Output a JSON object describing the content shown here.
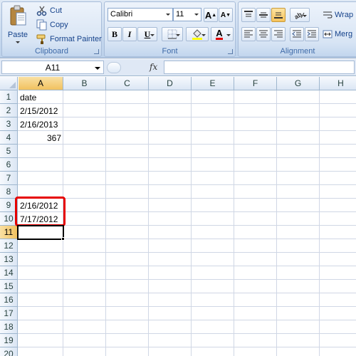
{
  "clipboard": {
    "paste_label": "Paste",
    "cut_label": "Cut",
    "copy_label": "Copy",
    "format_painter_label": "Format Painter",
    "group_label": "Clipboard"
  },
  "font": {
    "font_name": "Calibri",
    "font_size": "11",
    "bold_label": "B",
    "italic_label": "I",
    "underline_label": "U",
    "grow_label": "A",
    "shrink_label": "A",
    "font_color_label": "A",
    "group_label": "Font",
    "font_color_hex": "#e00000",
    "highlight_color_hex": "#ffff00"
  },
  "alignment": {
    "wrap_label": "Wrap",
    "merge_label": "Merg",
    "group_label": "Alignment"
  },
  "formula_bar": {
    "name_box": "A11",
    "fx_label": "fx",
    "formula_value": ""
  },
  "columns": [
    "A",
    "B",
    "C",
    "D",
    "E",
    "F",
    "G",
    "H"
  ],
  "selected_column": "A",
  "rows": [
    "1",
    "2",
    "3",
    "4",
    "5",
    "6",
    "7",
    "8",
    "9",
    "10",
    "11",
    "12",
    "13",
    "14",
    "15",
    "16",
    "17",
    "18",
    "19",
    "20"
  ],
  "selected_row": "11",
  "cells": {
    "A1": "date",
    "A2": "2/15/2012",
    "A3": "2/16/2013",
    "A4": "367",
    "A9": "2/16/2012",
    "A10": "7/17/2012"
  },
  "colors": {
    "highlight_border": "#e60000",
    "selected_header": "#f1c15f",
    "ribbon_bg": "#c4d7ee"
  }
}
